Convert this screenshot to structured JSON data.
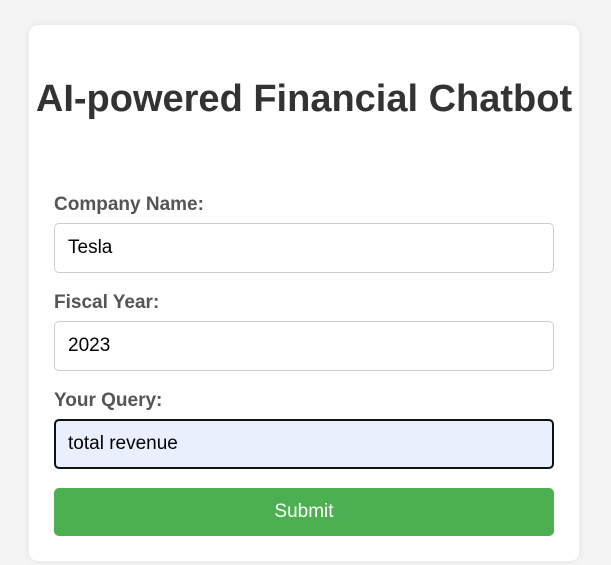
{
  "title": "AI-powered Financial Chatbot",
  "form": {
    "company": {
      "label": "Company Name:",
      "value": "Tesla"
    },
    "fiscal_year": {
      "label": "Fiscal Year:",
      "value": "2023"
    },
    "query": {
      "label": "Your Query:",
      "value": "total revenue"
    },
    "submit_label": "Submit"
  },
  "colors": {
    "submit_background": "#4caf50",
    "focused_field_background": "#e8f0fe",
    "page_background": "#f4f4f4"
  }
}
